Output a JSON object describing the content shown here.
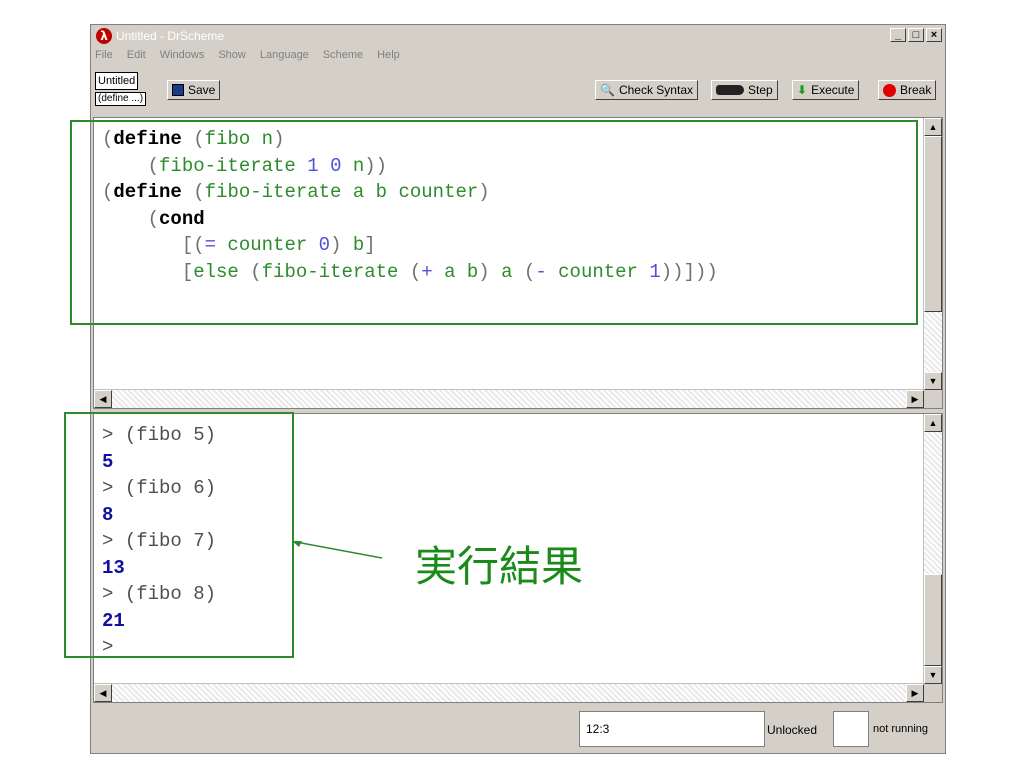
{
  "window": {
    "title": "Untitled - DrScheme",
    "buttons": [
      "_",
      "□",
      "×"
    ]
  },
  "menu": [
    "File",
    "Edit",
    "Windows",
    "Show",
    "Language",
    "Scheme",
    "Help"
  ],
  "toolbar": {
    "tab_name": "Untitled",
    "define_menu": "(define ...)",
    "save": "Save",
    "check_syntax": "Check Syntax",
    "step": "Step",
    "execute": "Execute",
    "break": "Break"
  },
  "definitions": [
    [
      [
        "p",
        "("
      ],
      [
        "kw",
        "define"
      ],
      [
        "p",
        " ("
      ],
      [
        "g",
        "fibo n"
      ],
      [
        "p",
        ")"
      ]
    ],
    [
      [
        "p",
        "    ("
      ],
      [
        "g",
        "fibo-iterate "
      ],
      [
        "n",
        "1"
      ],
      [
        "g",
        " "
      ],
      [
        "n",
        "0"
      ],
      [
        "g",
        " n"
      ],
      [
        "p",
        "))"
      ]
    ],
    [
      [
        "p",
        "("
      ],
      [
        "kw",
        "define"
      ],
      [
        "p",
        " ("
      ],
      [
        "g",
        "fibo-iterate a b counter"
      ],
      [
        "p",
        ")"
      ]
    ],
    [
      [
        "p",
        "    ("
      ],
      [
        "kw",
        "cond"
      ]
    ],
    [
      [
        "p",
        "       [("
      ],
      [
        "n",
        "="
      ],
      [
        "g",
        " counter "
      ],
      [
        "n",
        "0"
      ],
      [
        "p",
        ") "
      ],
      [
        "g",
        "b"
      ],
      [
        "p",
        "]"
      ]
    ],
    [
      [
        "p",
        "       ["
      ],
      [
        "g",
        "else"
      ],
      [
        "p",
        " ("
      ],
      [
        "g",
        "fibo-iterate"
      ],
      [
        "p",
        " ("
      ],
      [
        "n",
        "+"
      ],
      [
        "g",
        " a b"
      ],
      [
        "p",
        ") "
      ],
      [
        "g",
        "a"
      ],
      [
        "p",
        " ("
      ],
      [
        "n",
        "-"
      ],
      [
        "g",
        " counter "
      ],
      [
        "n",
        "1"
      ],
      [
        "p",
        "))]))"
      ]
    ]
  ],
  "interactions": [
    {
      "prompt": "> ",
      "input": "(fibo 5)",
      "result": "5"
    },
    {
      "prompt": "> ",
      "input": "(fibo 6)",
      "result": "8"
    },
    {
      "prompt": "> ",
      "input": "(fibo 7)",
      "result": "13"
    },
    {
      "prompt": "> ",
      "input": "(fibo 8)",
      "result": "21"
    }
  ],
  "final_prompt": ">",
  "status": {
    "position": "12:3",
    "lock": "Unlocked",
    "running": "not running"
  },
  "annotation": {
    "label": "実行結果",
    "color": "#2e8b2e"
  },
  "colors": {
    "keyword": "#000000",
    "identifier": "#2e8b2e",
    "number": "#5050d8",
    "result": "#1010a0"
  }
}
